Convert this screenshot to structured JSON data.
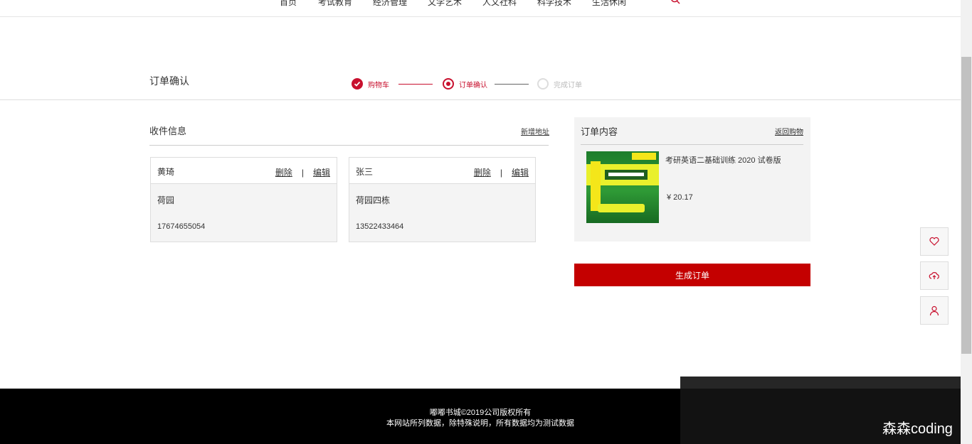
{
  "nav": {
    "items": [
      "首页",
      "考试教育",
      "经济管理",
      "文学艺术",
      "人文社科",
      "科学技术",
      "生活休闲"
    ]
  },
  "header": {
    "title": "订单确认"
  },
  "steps": [
    {
      "label": "购物车",
      "state": "done"
    },
    {
      "label": "订单确认",
      "state": "current"
    },
    {
      "label": "完成订单",
      "state": "pending"
    }
  ],
  "shipping": {
    "title": "收件信息",
    "new_address": "新增地址",
    "delete_label": "删除",
    "separator": "|",
    "edit_label": "编辑",
    "addresses": [
      {
        "name": "黄琦",
        "address": "荷园",
        "phone": "17674655054"
      },
      {
        "name": "张三",
        "address": "荷园四栋",
        "phone": "13522433464"
      }
    ]
  },
  "order": {
    "title": "订单内容",
    "back_link": "返回购物",
    "item": {
      "name": "考研英语二基础训练 2020 试卷版",
      "price": "¥ 20.17"
    },
    "submit_label": "生成订单"
  },
  "side_buttons": [
    "heart-icon",
    "cloud-upload-icon",
    "user-icon"
  ],
  "footer": {
    "copyright": "嘟嘟书城©2019公司版权所有",
    "note": "本网站所列数据，除特殊说明，所有数据均为测试数据"
  },
  "watermark": "森森coding",
  "colors": {
    "accent": "#c40000",
    "step_red": "#c8102e",
    "footer_bg": "#000000"
  }
}
